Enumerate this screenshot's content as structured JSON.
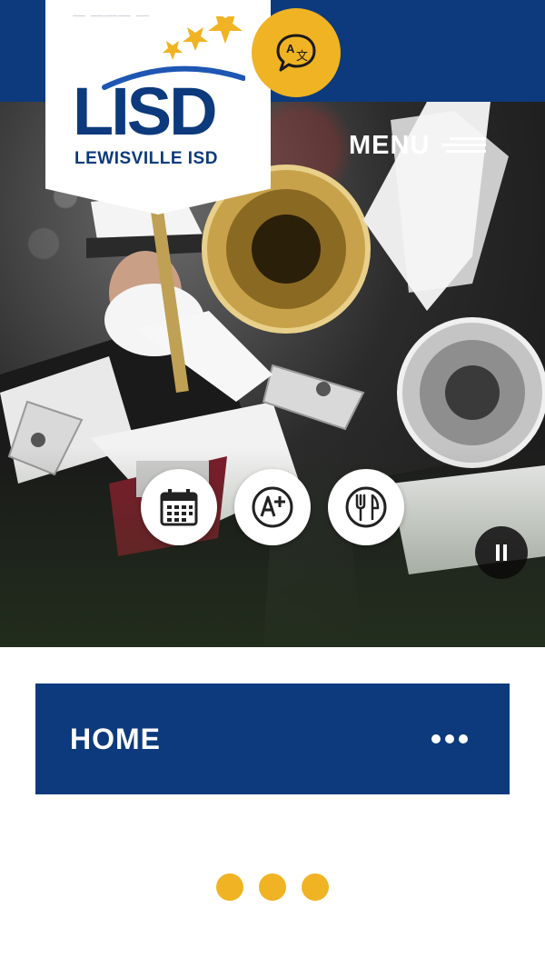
{
  "header": {
    "logo": {
      "wordmark": "LISD",
      "district_name": "LEWISVILLE ISD"
    },
    "translate_icon": "translate-icon",
    "menu": {
      "label": "MENU",
      "icon": "hamburger-icon"
    }
  },
  "hero": {
    "quick_links": [
      {
        "icon": "calendar-icon"
      },
      {
        "icon": "grades-icon"
      },
      {
        "icon": "dining-icon"
      }
    ],
    "pause_icon": "pause-icon"
  },
  "main": {
    "section_title": "HOME",
    "more_icon": "more-dots-icon"
  },
  "colors": {
    "brand_blue": "#0c3a7c",
    "accent_gold": "#f0b323",
    "white": "#ffffff"
  }
}
